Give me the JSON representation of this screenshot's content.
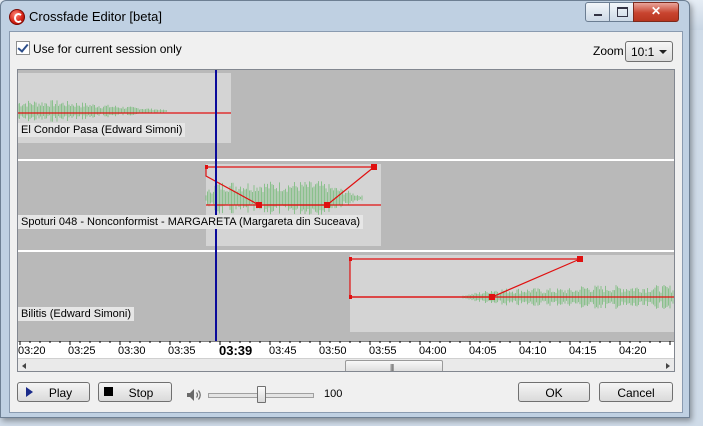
{
  "window": {
    "title": "Crossfade Editor [beta]",
    "controls": {
      "minimize": "minimize",
      "maximize": "maximize",
      "close": "✕"
    }
  },
  "options": {
    "session_only_label": "Use for current session only",
    "session_only_checked": true,
    "zoom_label": "Zoom",
    "zoom_value": "10:1"
  },
  "tracks": [
    {
      "label": "El Condor Pasa (Edward Simoni)"
    },
    {
      "label": "Spoturi 048 - Nonconformist - MARGARETA (Margareta din Suceava)"
    },
    {
      "label": "Bilitis (Edward Simoni)"
    }
  ],
  "timeline": {
    "ticks": [
      "03:20",
      "03:25",
      "03:30",
      "03:35",
      "03:39",
      "03:45",
      "03:50",
      "03:55",
      "04:00",
      "04:05",
      "04:10",
      "04:15",
      "04:20"
    ],
    "current_time": "03:39"
  },
  "scrollbar": {
    "grip": "|||"
  },
  "colors": {
    "playhead": "#0a0a9a",
    "envelope": "#e01010",
    "waveform": "#4caf50"
  },
  "buttons": {
    "play": "Play",
    "stop": "Stop",
    "ok": "OK",
    "cancel": "Cancel"
  },
  "volume": {
    "value": "100",
    "level": 0.5
  }
}
